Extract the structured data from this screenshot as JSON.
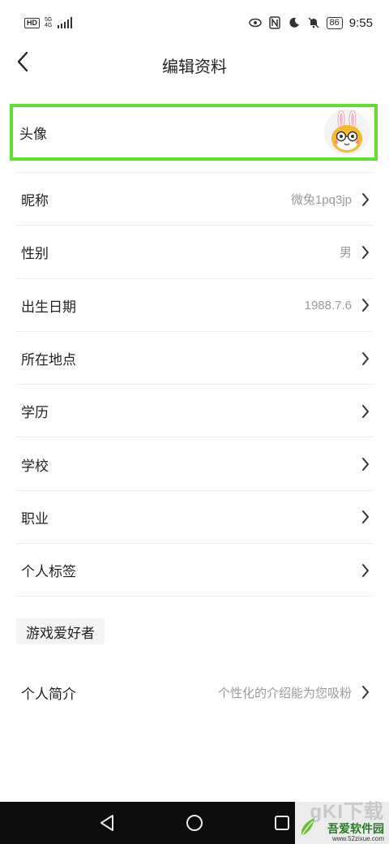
{
  "status_bar": {
    "hd": "HD",
    "net_top": "5G",
    "net_bottom": "4G",
    "battery": "86",
    "time": "9:55"
  },
  "nav": {
    "title": "编辑资料",
    "back_icon": "chevron-left-icon"
  },
  "avatar_row": {
    "label": "头像",
    "highlight_color": "#5de12a"
  },
  "rows": [
    {
      "label": "昵称",
      "value": "微兔1pq3jp"
    },
    {
      "label": "性别",
      "value": "男"
    },
    {
      "label": "出生日期",
      "value": "1988.7.6"
    },
    {
      "label": "所在地点",
      "value": ""
    },
    {
      "label": "学历",
      "value": ""
    },
    {
      "label": "学校",
      "value": ""
    },
    {
      "label": "职业",
      "value": ""
    },
    {
      "label": "个人标签",
      "value": ""
    }
  ],
  "tag": "游戏爱好者",
  "intro": {
    "label": "个人简介",
    "placeholder": "个性化的介绍能为您吸粉"
  },
  "watermark": {
    "big": "gKI下载",
    "name": "吾爱软件园",
    "url": "www.52zixue.com"
  }
}
